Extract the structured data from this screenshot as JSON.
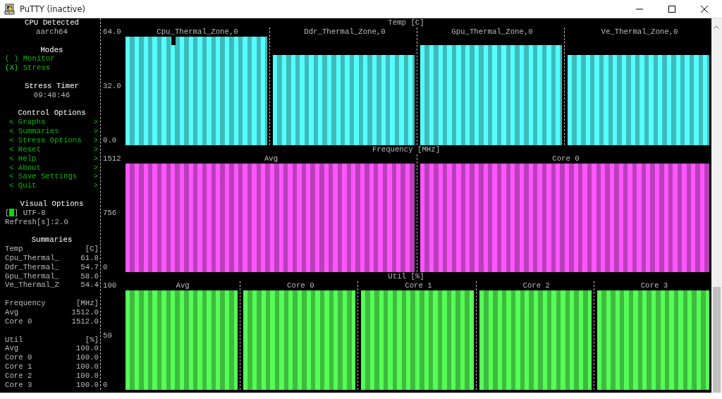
{
  "window": {
    "title": "PuTTY (inactive)"
  },
  "sidebar": {
    "cpu": {
      "title": "CPU Detected",
      "value": "aarch64"
    },
    "modes": {
      "title": "Modes",
      "items": [
        {
          "marker": "( )",
          "label": "Monitor",
          "selected": false
        },
        {
          "marker": "(X)",
          "label": "Stress",
          "selected": true
        }
      ]
    },
    "timer": {
      "title": "Stress Timer",
      "value": "09:48:46"
    },
    "control_options": {
      "title": "Control Options",
      "items": [
        {
          "left": "<",
          "label": "Graphs",
          "right": ">"
        },
        {
          "left": "<",
          "label": "Summaries",
          "right": ">"
        },
        {
          "left": "<",
          "label": "Stress Options",
          "right": ">"
        },
        {
          "left": "<",
          "label": "Reset",
          "right": ">"
        },
        {
          "left": "<",
          "label": "Help",
          "right": ">"
        },
        {
          "left": "<",
          "label": "About",
          "right": ">"
        },
        {
          "left": "<",
          "label": "Save Settings",
          "right": ">"
        },
        {
          "left": "<",
          "label": "Quit",
          "right": ">"
        }
      ]
    },
    "visual_options": {
      "title": "Visual Options",
      "checkbox": {
        "bracket_left": "[",
        "bracket_right": "]",
        "label": "UTF-8",
        "focused": true
      },
      "refresh": "Refresh[s]:2.0"
    },
    "summaries": {
      "title": "Summaries",
      "groups": [
        {
          "name": "Temp",
          "unit": "[C]",
          "rows": [
            {
              "name": "Cpu_Thermal_",
              "value": "61.8"
            },
            {
              "name": "Ddr_Thermal_",
              "value": "54.7"
            },
            {
              "name": "Gpu_Thermal_",
              "value": "58.6"
            },
            {
              "name": "Ve_Thermal_Z",
              "value": "54.4"
            }
          ]
        },
        {
          "name": "Frequency",
          "unit": "[MHz]",
          "rows": [
            {
              "name": "Avg",
              "value": "1512.0"
            },
            {
              "name": "Core 0",
              "value": "1512.0"
            }
          ]
        },
        {
          "name": "Util",
          "unit": "[%]",
          "rows": [
            {
              "name": "Avg",
              "value": "100.0"
            },
            {
              "name": "Core 0",
              "value": "100.0"
            },
            {
              "name": "Core 1",
              "value": "100.0"
            },
            {
              "name": "Core 2",
              "value": "100.0"
            },
            {
              "name": "Core 3",
              "value": "100.0"
            }
          ]
        }
      ]
    }
  },
  "graphs": [
    {
      "title": "Temp [C]",
      "ticks": [
        "64.0",
        "32.0",
        "0.0"
      ],
      "color": "#55ffff",
      "panels": [
        {
          "label": "Cpu_Thermal_Zone,0",
          "cursor": true
        },
        {
          "label": "Ddr_Thermal_Zone,0",
          "cursor": false
        },
        {
          "label": "Gpu_Thermal_Zone,0",
          "cursor": false
        },
        {
          "label": "Ve_Thermal_Zone,0",
          "cursor": false
        }
      ]
    },
    {
      "title": "Frequency [MHz]",
      "ticks": [
        "1512",
        "756",
        "0"
      ],
      "color": "#ff55ff",
      "panels": [
        {
          "label": "Avg",
          "cursor": false
        },
        {
          "label": "Core 0",
          "cursor": false
        }
      ]
    },
    {
      "title": "Util [%]",
      "ticks": [
        "100",
        "50",
        "0"
      ],
      "color": "#55ff55",
      "panels": [
        {
          "label": "Avg",
          "cursor": false
        },
        {
          "label": "Core 0",
          "cursor": false
        },
        {
          "label": "Core 1",
          "cursor": false
        },
        {
          "label": "Core 2",
          "cursor": false
        },
        {
          "label": "Core 3",
          "cursor": false
        }
      ]
    }
  ]
}
